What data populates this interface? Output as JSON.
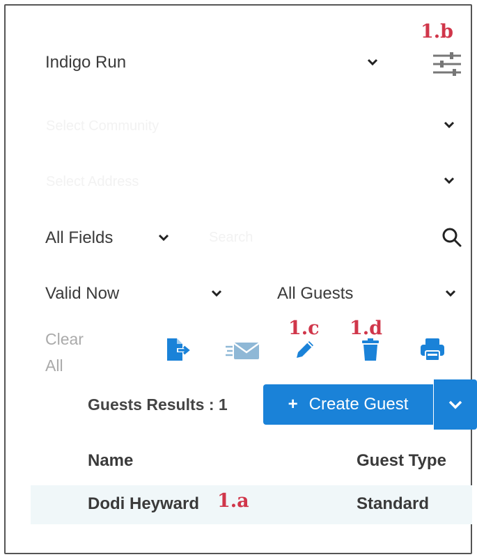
{
  "filters": {
    "property": "Indigo Run",
    "blurred_row_1": "Select Community",
    "blurred_row_2": "Select Address",
    "search_field_selector": "All Fields",
    "search_placeholder": "Search",
    "validity": "Valid Now",
    "guest_filter": "All Guests",
    "clear_all": "Clear All"
  },
  "annotations": {
    "settings": "1.b",
    "edit": "1.c",
    "delete": "1.d",
    "row": "1.a"
  },
  "results": {
    "count_label": "Guests Results : 1",
    "create_button": "Create Guest"
  },
  "table": {
    "headers": [
      "Name",
      "Guest Type"
    ],
    "rows": [
      {
        "name": "Dodi Heyward",
        "guest_type": "Standard"
      }
    ]
  },
  "icons": {
    "settings": "sliders-icon",
    "export": "export-file-icon",
    "send": "send-envelope-icon",
    "edit": "pencil-icon",
    "delete": "trash-icon",
    "print": "printer-icon",
    "search": "search-icon"
  },
  "colors": {
    "primary": "#1a82d8",
    "annotation": "#d0364a",
    "icon_blue": "#1a82d8",
    "icon_muted": "#8fb8d6"
  }
}
